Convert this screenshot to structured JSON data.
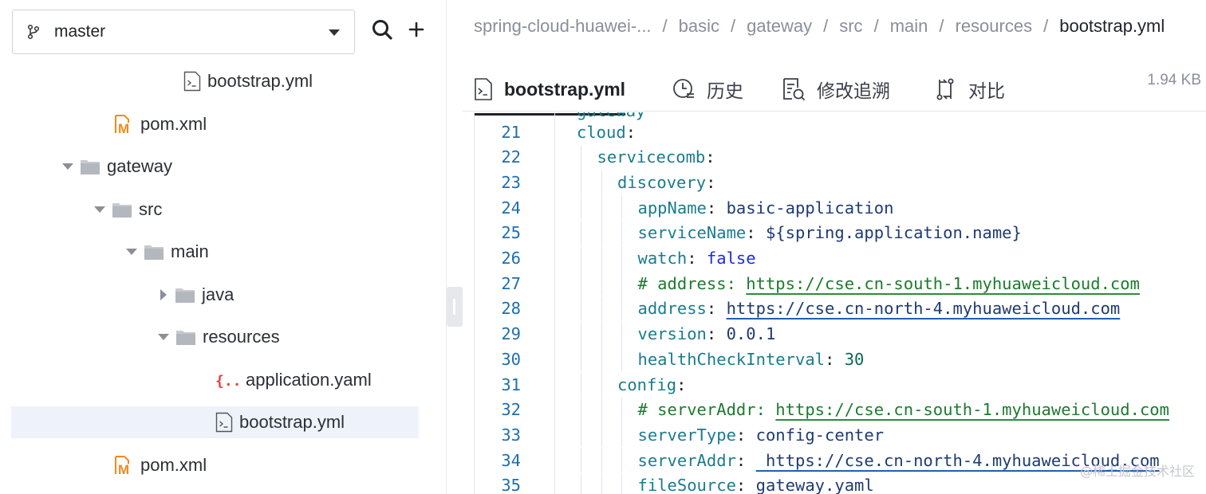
{
  "sidebar": {
    "branch": "master",
    "tree": [
      {
        "label": "bootstrap.yml",
        "icon": "yaml-file-icon",
        "indent": 4,
        "caret": "none"
      },
      {
        "label": "pom.xml",
        "icon": "maven-file-icon",
        "indent": 2,
        "caret": "none"
      },
      {
        "label": "gateway",
        "icon": "folder-icon",
        "indent": 1,
        "caret": "down"
      },
      {
        "label": "src",
        "icon": "folder-icon",
        "indent": 2,
        "caret": "down"
      },
      {
        "label": "main",
        "icon": "folder-icon",
        "indent": 3,
        "caret": "down"
      },
      {
        "label": "java",
        "icon": "folder-icon",
        "indent": 4,
        "caret": "right"
      },
      {
        "label": "resources",
        "icon": "folder-icon",
        "indent": 4,
        "caret": "down"
      },
      {
        "label": "application.yaml",
        "icon": "yaml-red-icon",
        "indent": 5,
        "caret": "none"
      },
      {
        "label": "bootstrap.yml",
        "icon": "yaml-file-icon",
        "indent": 5,
        "caret": "none",
        "selected": true
      },
      {
        "label": "pom.xml",
        "icon": "maven-file-icon",
        "indent": 2,
        "caret": "none"
      }
    ]
  },
  "breadcrumb": [
    "spring-cloud-huawei-...",
    "basic",
    "gateway",
    "src",
    "main",
    "resources",
    "bootstrap.yml"
  ],
  "tabs": [
    {
      "label": "bootstrap.yml",
      "icon": "file-terminal-icon",
      "active": true
    },
    {
      "label": "历史",
      "icon": "history-icon"
    },
    {
      "label": "修改追溯",
      "icon": "blame-icon"
    },
    {
      "label": "对比",
      "icon": "compare-icon"
    }
  ],
  "file_size": "1.94 KB",
  "code": {
    "partial_top": "gateway",
    "lines": [
      {
        "n": "21",
        "indent": 0,
        "key": "cloud",
        "value": "",
        "type": "plain"
      },
      {
        "n": "22",
        "indent": 1,
        "key": "servicecomb",
        "value": "",
        "type": "plain"
      },
      {
        "n": "23",
        "indent": 2,
        "key": "discovery",
        "value": "",
        "type": "plain"
      },
      {
        "n": "24",
        "indent": 3,
        "key": "appName",
        "value": "basic-application",
        "type": "str"
      },
      {
        "n": "25",
        "indent": 3,
        "key": "serviceName",
        "value": "${spring.application.name}",
        "type": "str"
      },
      {
        "n": "26",
        "indent": 3,
        "key": "watch",
        "value": "false",
        "type": "bool"
      },
      {
        "n": "27",
        "indent": 3,
        "key": "# address",
        "value": "https://cse.cn-south-1.myhuaweicloud.com",
        "type": "comment"
      },
      {
        "n": "28",
        "indent": 3,
        "key": "address",
        "value": "https://cse.cn-north-4.myhuaweicloud.com",
        "type": "link"
      },
      {
        "n": "29",
        "indent": 3,
        "key": "version",
        "value": "0.0.1",
        "type": "str"
      },
      {
        "n": "30",
        "indent": 3,
        "key": "healthCheckInterval",
        "value": "30",
        "type": "num"
      },
      {
        "n": "31",
        "indent": 2,
        "key": "config",
        "value": "",
        "type": "plain"
      },
      {
        "n": "32",
        "indent": 3,
        "key": "# serverAddr",
        "value": "https://cse.cn-south-1.myhuaweicloud.com",
        "type": "comment"
      },
      {
        "n": "33",
        "indent": 3,
        "key": "serverType",
        "value": "config-center",
        "type": "str"
      },
      {
        "n": "34",
        "indent": 3,
        "key": "serverAddr",
        "value": " https://cse.cn-north-4.myhuaweicloud.com",
        "type": "link"
      },
      {
        "n": "35",
        "indent": 3,
        "key": "fileSource",
        "value": "gateway.yaml",
        "type": "str"
      }
    ]
  },
  "watermark": "@稀土掘金技术社区"
}
